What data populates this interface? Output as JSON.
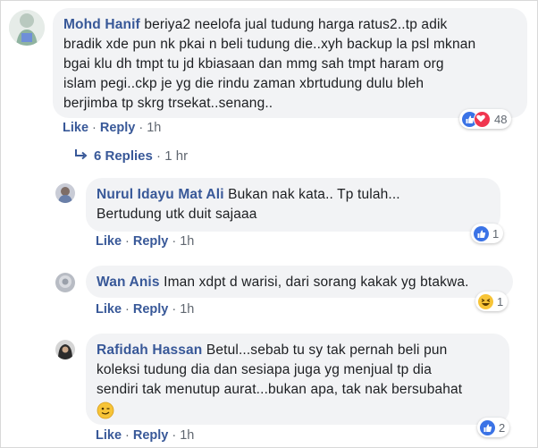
{
  "comments": [
    {
      "author": "Mohd Hanif",
      "text": "beriya2 neelofa jual tudung harga ratus2..tp adik",
      "lines": [
        "bradik xde pun nk pkai n beli tudung die..xyh backup la psl mknan",
        "bgai klu dh tmpt tu jd kbiasaan dan mmg sah tmpt haram org",
        "islam pegi..ckp je yg die rindu zaman xbrtudung dulu bleh",
        "berjimba tp skrg trsekat..senang.."
      ],
      "like_label": "Like",
      "reply_label": "Reply",
      "time": "1h",
      "reaction_count": "48",
      "reactions": [
        "like-icon",
        "love-icon"
      ]
    }
  ],
  "replies_toggle": {
    "label": "6 Replies",
    "time": "1 hr"
  },
  "replies": [
    {
      "author": "Nurul Idayu Mat Ali",
      "first": "Bukan nak kata.. Tp tulah...",
      "lines": [
        "Bertudung utk duit sajaaa"
      ],
      "like_label": "Like",
      "reply_label": "Reply",
      "time": "1h",
      "reaction_count": "1",
      "reaction": "like-icon"
    },
    {
      "author": "Wan Anis",
      "first": "Iman xdpt d warisi, dari sorang kakak yg btakwa.",
      "lines": [],
      "like_label": "Like",
      "reply_label": "Reply",
      "time": "1h",
      "reaction_count": "1",
      "reaction": "haha-icon"
    },
    {
      "author": "Rafidah Hassan",
      "first": "Betul...sebab tu sy tak pernah beli pun",
      "lines": [
        "koleksi tudung dia dan sesiapa juga yg menjual tp dia",
        "sendiri tak menutup aurat...bukan apa, tak nak bersubahat"
      ],
      "emoji": "wink-emoji",
      "like_label": "Like",
      "reply_label": "Reply",
      "time": "1h",
      "reaction_count": "2",
      "reaction": "like-icon"
    }
  ],
  "colors": {
    "link": "#385898",
    "bubble": "#f2f3f5",
    "like": "#3b73e6",
    "love": "#f0364f",
    "haha": "#f7c437"
  }
}
